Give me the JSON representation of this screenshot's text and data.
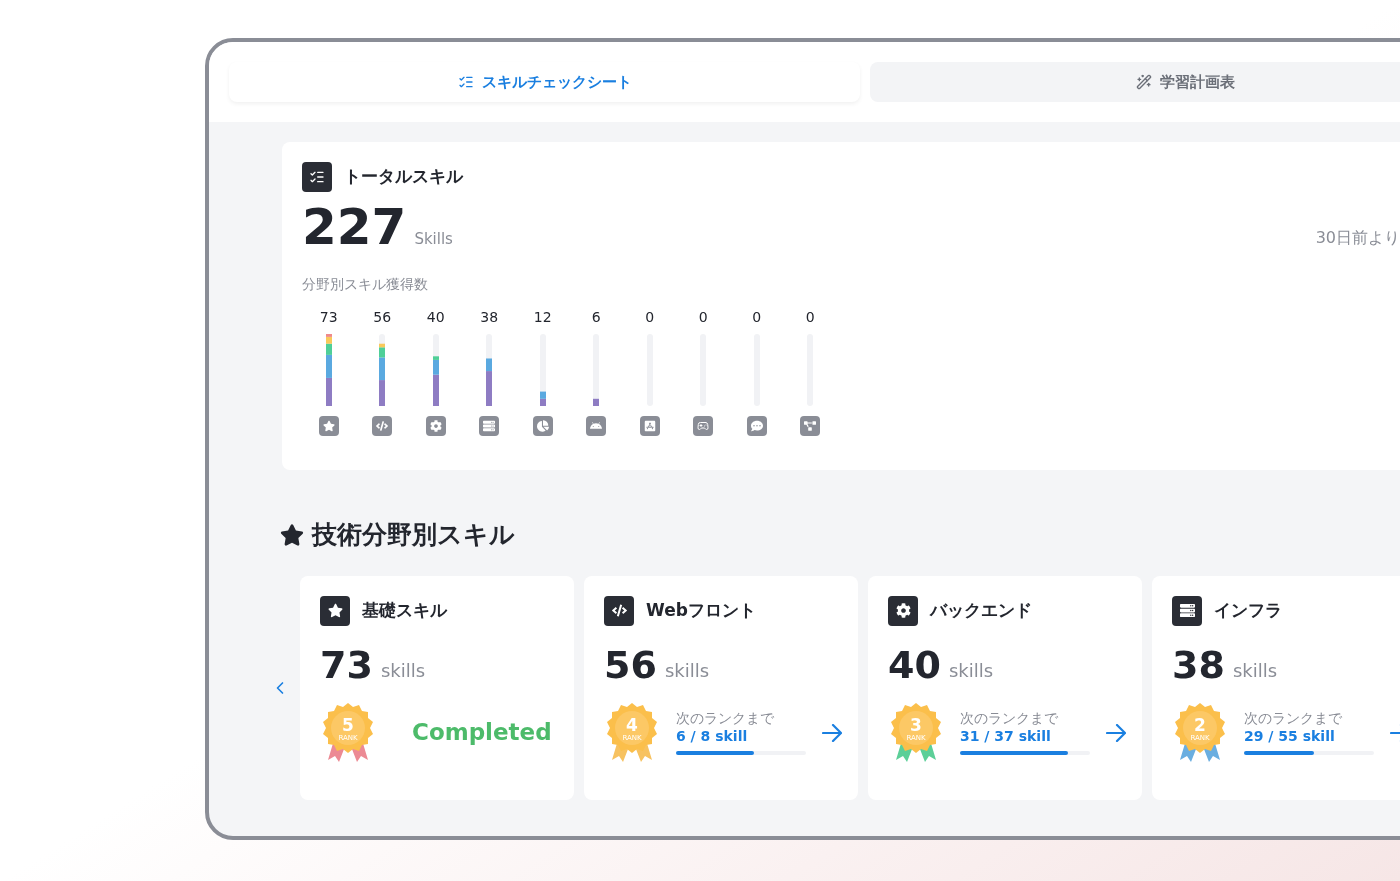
{
  "tabs": [
    {
      "label": "スキルチェックシート",
      "selected": true
    },
    {
      "label": "学習計画表",
      "selected": false
    }
  ],
  "total": {
    "title": "トータルスキル",
    "count": "227",
    "unit": "Skills",
    "since": "30日前より",
    "subtitle": "分野別スキル獲得数",
    "columns": [
      {
        "count": "73"
      },
      {
        "count": "56"
      },
      {
        "count": "40"
      },
      {
        "count": "38"
      },
      {
        "count": "12"
      },
      {
        "count": "6"
      },
      {
        "count": "0"
      },
      {
        "count": "0"
      },
      {
        "count": "0"
      },
      {
        "count": "0"
      }
    ]
  },
  "section": {
    "title": "技術分野別スキル"
  },
  "cards": [
    {
      "kind": "completed",
      "title": "基礎スキル",
      "count": "73",
      "unit": "skills",
      "rank": "5",
      "rank_label": "RANK",
      "color": "#ec8a94",
      "status": "Completed"
    },
    {
      "kind": "progress",
      "title": "Webフロント",
      "count": "56",
      "unit": "skills",
      "rank": "4",
      "rank_label": "RANK",
      "color": "#f7c260",
      "next_label": "次のランクまで",
      "progress_text": "6 / 8 skill",
      "level": 0.6
    },
    {
      "kind": "progress",
      "title": "バックエンド",
      "count": "40",
      "unit": "skills",
      "rank": "3",
      "rank_label": "RANK",
      "color": "#5ccf98",
      "next_label": "次のランクまで",
      "progress_text": "31 / 37 skill",
      "level": 0.83
    },
    {
      "kind": "progress",
      "title": "インフラ",
      "count": "38",
      "unit": "skills",
      "rank": "2",
      "rank_label": "RANK",
      "color": "#6aaee0",
      "next_label": "次のランクまで",
      "progress_text": "29 / 55 skill",
      "level": 0.54
    }
  ]
}
